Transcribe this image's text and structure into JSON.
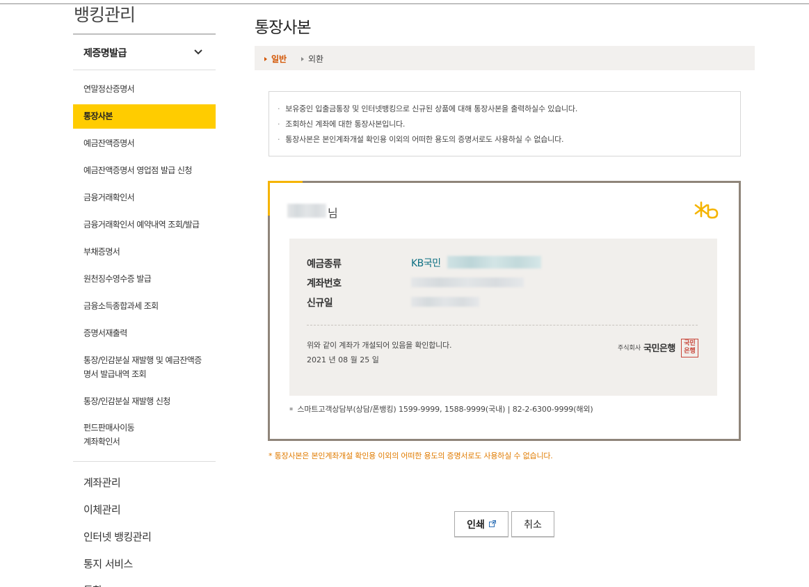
{
  "sidebar": {
    "title": "뱅킹관리",
    "group_label": "제증명발급",
    "items": [
      {
        "label": "연말정산증명서"
      },
      {
        "label": "통장사본"
      },
      {
        "label": "예금잔액증명서"
      },
      {
        "label": "예금잔액증명서 영업점 발급 신청"
      },
      {
        "label": "금융거래확인서"
      },
      {
        "label": "금융거래확인서 예약내역 조회/발급"
      },
      {
        "label": "부채증명서"
      },
      {
        "label": "원천징수영수증 발급"
      },
      {
        "label": "금융소득종합과세 조회"
      },
      {
        "label": "증명서재출력"
      },
      {
        "label_line1": "통장/인감분실 재발행 및 예금잔액증",
        "label_line2": "명서 발급내역 조회"
      },
      {
        "label": "통장/인감분실 재발행 신청"
      },
      {
        "label_line1": "펀드판매사이동",
        "label_line2": "계좌확인서"
      }
    ],
    "active_index": 1,
    "major_menus": [
      "계좌관리",
      "이체관리",
      "인터넷 뱅킹관리",
      "통지 서비스",
      "통합"
    ]
  },
  "main": {
    "page_title": "통장사본",
    "tabs": [
      {
        "label": "일반",
        "active": true
      },
      {
        "label": "외환",
        "active": false
      }
    ],
    "notices": [
      "보유중인 입출금통장 및 인터넷뱅킹으로 신규된 상품에 대해 통장사본을 출력하실수 있습니다.",
      "조회하신 계좌에 대한 통장사본입니다.",
      "통장사본은 본인계좌개설 확인용 이외의 어떠한 용도의 증명서로도 사용하실 수 없습니다."
    ],
    "certificate": {
      "holder_suffix": "님",
      "logo_icon": "kb-star-logo-icon",
      "fields": {
        "deposit_type_label": "예금종류",
        "deposit_type_value_prefix": "KB국민",
        "account_number_label": "계좌번호",
        "open_date_label": "신규일"
      },
      "confirm_text": "위와 같이 계좌가 개설되어 있음을 확인합니다.",
      "issue_date": "2021 년 08 월 25 일",
      "bank_corp": "주식회사",
      "bank_name": "국민은행",
      "seal_text_line1": "국민",
      "seal_text_line2": "은행",
      "contact": "스마트고객상담부(상담/폰뱅킹) 1599-9999, 1588-9999(국내) | 82-2-6300-9999(해외)"
    },
    "warning": "* 통장사본은 본인계좌개설 확인용 이외의 어떠한 용도의 증명서로도 사용하실 수 없습니다.",
    "buttons": {
      "print": "인쇄",
      "cancel": "취소"
    }
  },
  "colors": {
    "accent_yellow": "#ffcc00",
    "tab_active": "#d35400",
    "warning_text": "#e07b00",
    "kb_teal": "#0d6f82"
  }
}
